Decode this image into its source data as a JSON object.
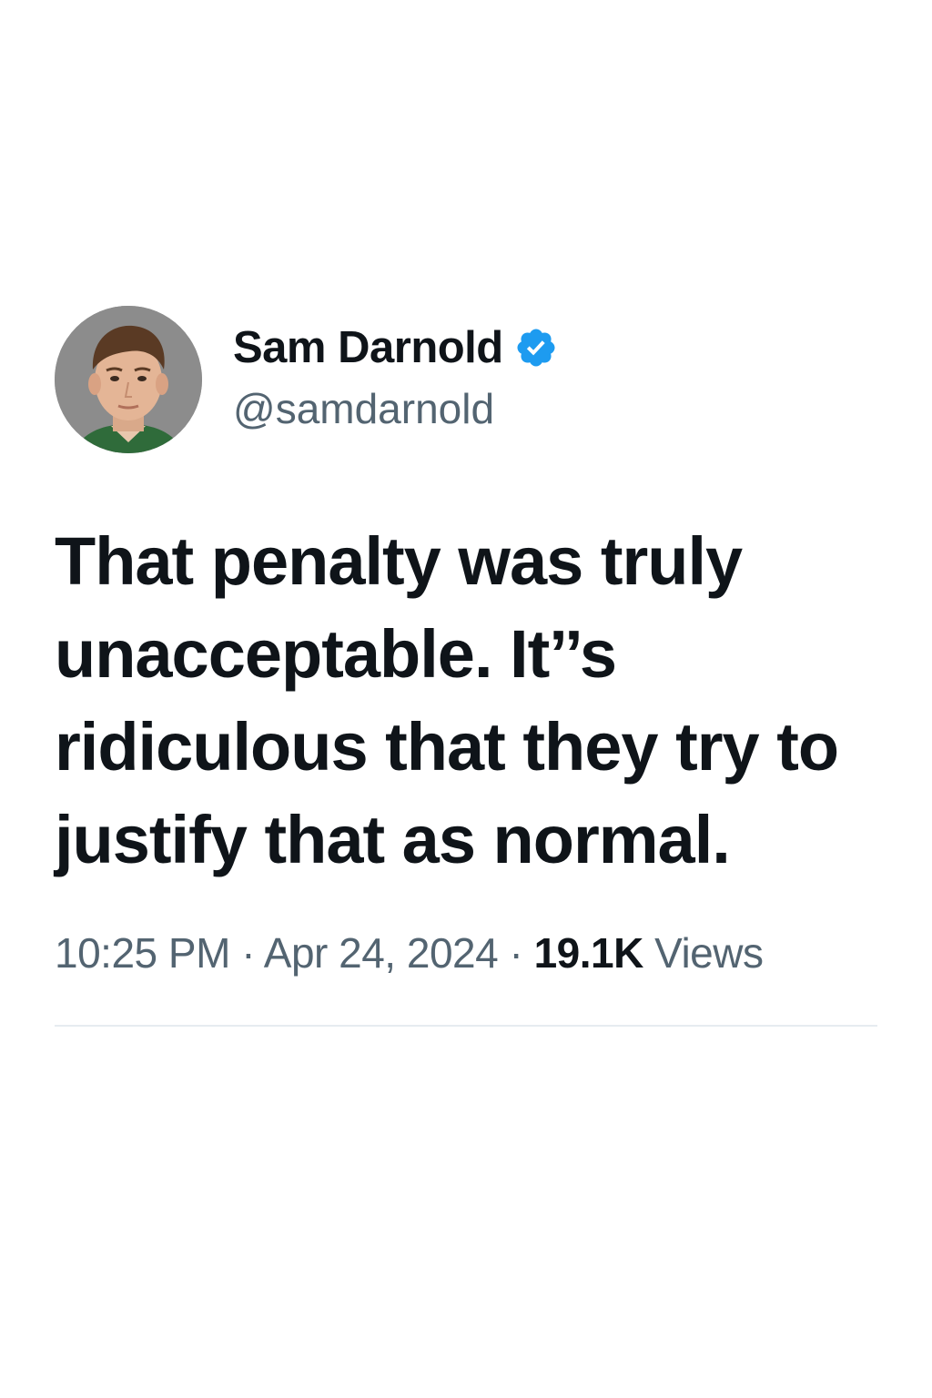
{
  "author": {
    "display_name": "Sam Darnold",
    "handle": "@samdarnold",
    "verified": true,
    "avatar_icon": "profile-photo"
  },
  "tweet": {
    "text": "That penalty was truly unacceptable. It’’s ridiculous that they try to justify that as normal."
  },
  "meta": {
    "time": "10:25 PM",
    "separator": "·",
    "date": "Apr 24, 2024",
    "views_count": "19.1K",
    "views_label": "Views"
  },
  "colors": {
    "text_primary": "#0f1419",
    "text_secondary": "#536471",
    "verified_blue": "#1d9bf0",
    "divider": "#e6ecf0"
  }
}
